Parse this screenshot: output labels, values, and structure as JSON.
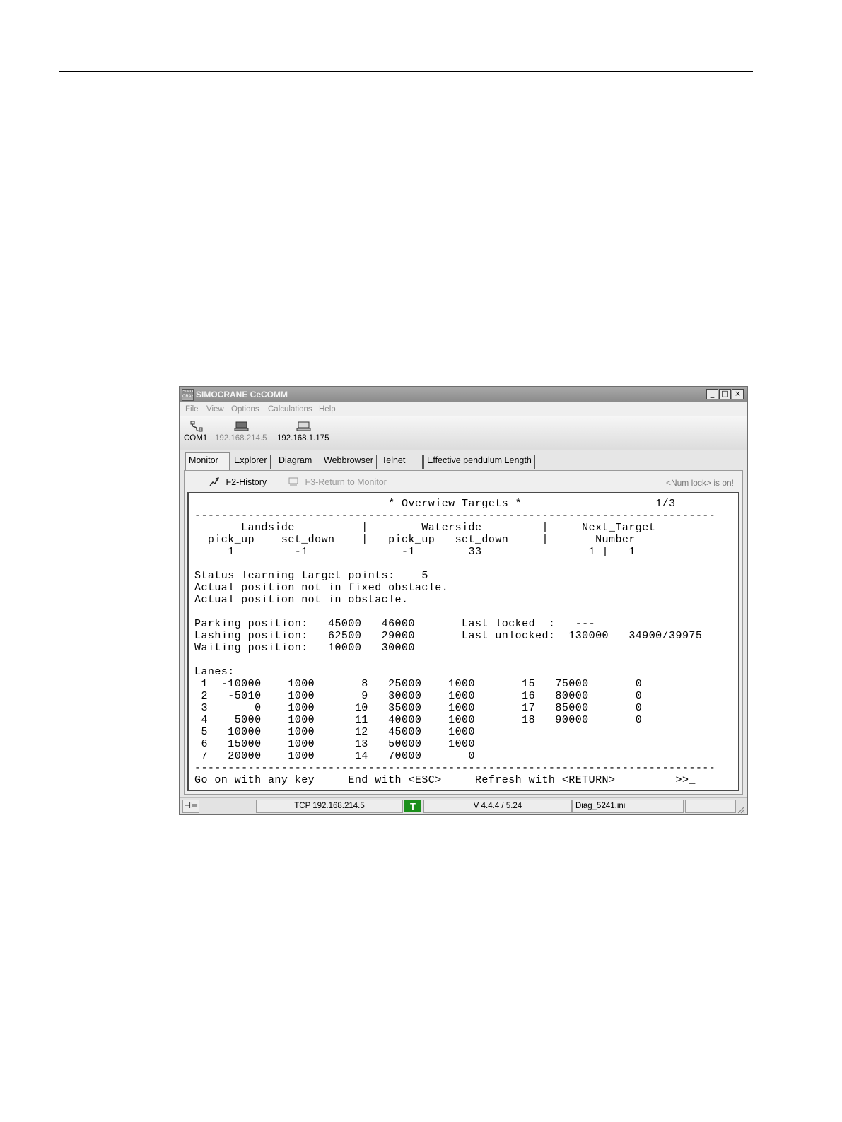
{
  "window": {
    "icon_text": "SIMO CRANE",
    "title": "SIMOCRANE CeCOMM",
    "minimize": "_",
    "maximize": "□",
    "close": "×"
  },
  "menu": [
    "File",
    "View",
    "Options",
    "Calculations",
    "Help"
  ],
  "toolbar": {
    "com": "COM1",
    "ip1": "192.168.214.5",
    "ip2": "192.168.1.175"
  },
  "tabs": [
    "Monitor",
    "Explorer",
    "Diagram",
    "Webbrowser",
    "Telnet",
    "Effective pendulum Length"
  ],
  "subbar": {
    "history": "F2-History",
    "return": "F3-Return to Monitor",
    "numlock": "<Num lock> is on!"
  },
  "terminal": {
    "lines": [
      "                             * Overwiew Targets *                    1/3",
      "------------------------------------------------------------------------------",
      "       Landside          |        Waterside         |     Next_Target",
      "  pick_up    set_down    |   pick_up   set_down     |       Number",
      "     1         -1              -1        33                1 |   1",
      "",
      "Status learning target points:    5",
      "Actual position not in fixed obstacle.",
      "Actual position not in obstacle.",
      "",
      "Parking position:   45000   46000       Last locked  :   ---",
      "Lashing position:   62500   29000       Last unlocked:  130000   34900/39975",
      "Waiting position:   10000   30000",
      "",
      "Lanes:",
      " 1  -10000    1000       8   25000    1000       15   75000       0",
      " 2   -5010    1000       9   30000    1000       16   80000       0",
      " 3       0    1000      10   35000    1000       17   85000       0",
      " 4    5000    1000      11   40000    1000       18   90000       0",
      " 5   10000    1000      12   45000    1000",
      " 6   15000    1000      13   50000    1000",
      " 7   20000    1000      14   70000       0",
      "------------------------------------------------------------------------------",
      "Go on with any key     End with <ESC>     Refresh with <RETURN>         >>_"
    ]
  },
  "status": {
    "pin": "⊣⊨",
    "connection": "TCP 192.168.214.5",
    "mode": "T",
    "version": "V 4.4.4 / 5.24",
    "file": "Diag_5241.ini"
  },
  "colors": {
    "title_bar": "#999999",
    "status_t": "#1b8f1b"
  }
}
